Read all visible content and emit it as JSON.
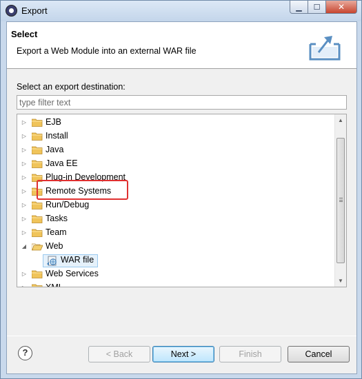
{
  "window": {
    "title": "Export"
  },
  "header": {
    "title": "Select",
    "description": "Export a Web Module into an external WAR file",
    "icon": "export-icon"
  },
  "prompt": "Select an export destination:",
  "filter": {
    "placeholder": "type filter text",
    "value": ""
  },
  "tree": {
    "items": [
      {
        "label": "EJB",
        "expanded": false
      },
      {
        "label": "Install",
        "expanded": false
      },
      {
        "label": "Java",
        "expanded": false
      },
      {
        "label": "Java EE",
        "expanded": false
      },
      {
        "label": "Plug-in Development",
        "expanded": false
      },
      {
        "label": "Remote Systems",
        "expanded": false
      },
      {
        "label": "Run/Debug",
        "expanded": false
      },
      {
        "label": "Tasks",
        "expanded": false
      },
      {
        "label": "Team",
        "expanded": false
      },
      {
        "label": "Web",
        "expanded": true,
        "children": [
          {
            "label": "WAR file",
            "selected": true
          }
        ]
      },
      {
        "label": "Web Services",
        "expanded": false
      },
      {
        "label": "XML",
        "expanded": false
      }
    ]
  },
  "buttons": {
    "back": "< Back",
    "next": "Next >",
    "finish": "Finish",
    "cancel": "Cancel"
  },
  "colors": {
    "highlight_border": "#e03030",
    "folder": "#e8b84a",
    "selection": "#e5f1fb"
  }
}
